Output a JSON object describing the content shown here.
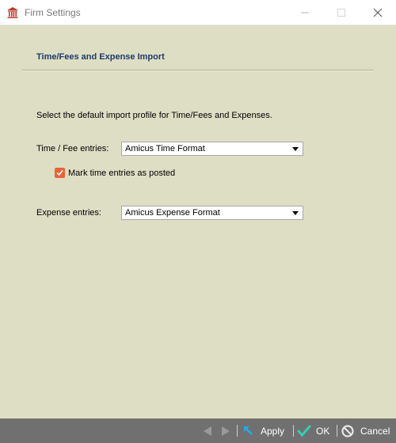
{
  "window": {
    "title": "Firm Settings",
    "controls": [
      "minimize",
      "maximize",
      "close"
    ]
  },
  "section": {
    "title": "Time/Fees and Expense Import",
    "intro": "Select the default import profile for Time/Fees and Expenses."
  },
  "time_fee": {
    "label": "Time / Fee entries:",
    "selected": "Amicus Time Format"
  },
  "mark_posted": {
    "label": "Mark time entries as posted",
    "checked": true
  },
  "expense": {
    "label": "Expense entries:",
    "selected": "Amicus Expense Format"
  },
  "footer": {
    "apply_label": "Apply",
    "ok_label": "OK",
    "cancel_label": "Cancel"
  },
  "colors": {
    "panel_bg": "#dedec4",
    "footer_bg": "#707070",
    "section_title": "#1f3a6b",
    "checkbox_accent": "#e8643a",
    "ok_check": "#2fd1b3",
    "apply_arrow": "#2aa8e0"
  },
  "icons": {
    "app": "courthouse-icon",
    "prev": "nav-previous-icon",
    "next": "nav-next-icon",
    "apply": "apply-arrow-icon",
    "ok": "checkmark-icon",
    "cancel": "cancel-circle-icon"
  }
}
